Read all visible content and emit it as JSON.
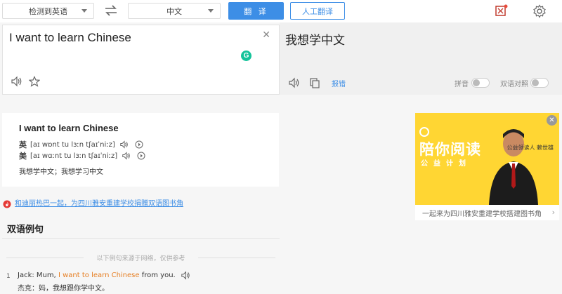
{
  "toolbar": {
    "source_lang": "检测到英语",
    "target_lang": "中文",
    "translate_label": "翻 译",
    "human_translate_label": "人工翻译"
  },
  "source": {
    "text": "I want to learn Chinese"
  },
  "target": {
    "text": "我想学中文",
    "report_label": "报错",
    "pinyin_label": "拼音",
    "bilingual_label": "双语对照"
  },
  "dict": {
    "word": "I want to learn Chinese",
    "uk_tag": "英",
    "uk_phonetic": "[aɪ wɒnt tu lɜːn  tʃaɪˈniːz]",
    "us_tag": "美",
    "us_phonetic": "[aɪ wɑːnt tu lɜːn  tʃaɪˈniːz]",
    "meaning": "我想学中文；我想学习中文"
  },
  "banner": {
    "link": "和迪丽热巴一起，为四川雅安重建学校捐赠双语图书角"
  },
  "ad": {
    "title": "陪你阅读",
    "subtitle": "公益计划",
    "name": "公益领读人 赖世雄",
    "caption": "一起来为四川雅安重建学校搭建图书角"
  },
  "examples": {
    "section_title": "双语例句",
    "source_note": "以下例句来源于网络，仅供参考",
    "items": [
      {
        "num": "1",
        "en_prefix": "Jack: Mum, ",
        "en_highlight": "I want to learn Chinese",
        "en_suffix": " from you.",
        "zh": "杰克：妈，我想跟你学中文。"
      }
    ]
  },
  "colors": {
    "accent": "#3d8ee6",
    "highlight": "#e67e22",
    "ad_bg": "#ffd633"
  }
}
